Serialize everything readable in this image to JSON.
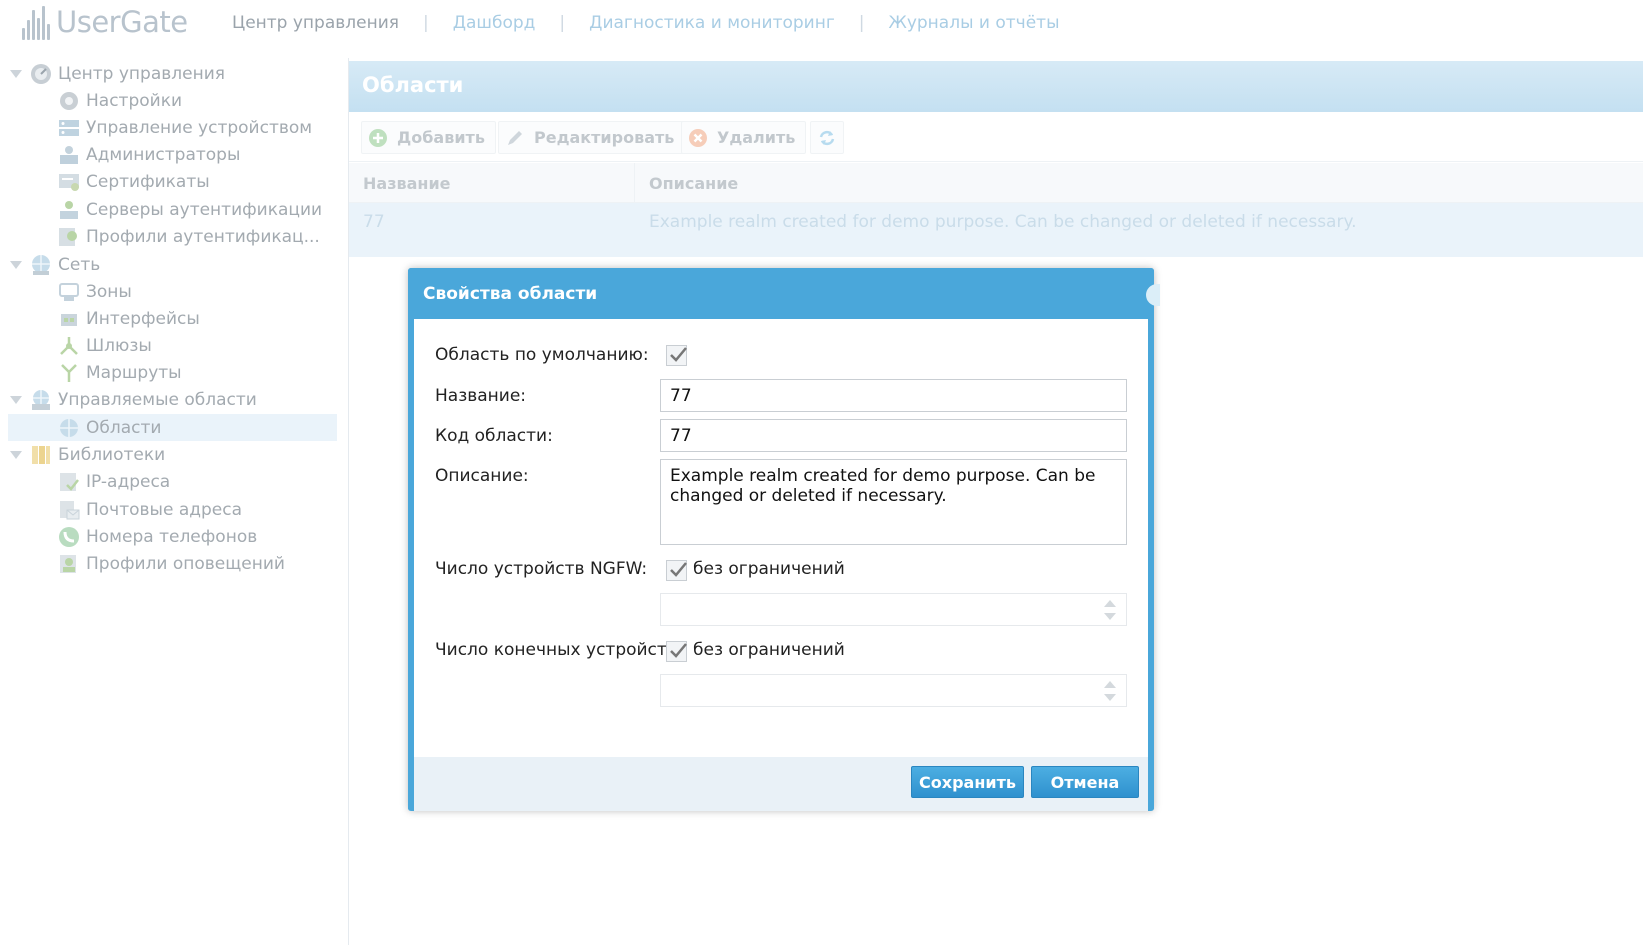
{
  "app": {
    "logo_text": "UserGate"
  },
  "topnav": {
    "items": [
      {
        "label": "Центр управления"
      },
      {
        "label": "Дашборд"
      },
      {
        "label": "Диагностика и мониторинг"
      },
      {
        "label": "Журналы и отчёты"
      }
    ],
    "separator": "|"
  },
  "sidebar": {
    "items": [
      {
        "label": "Центр управления",
        "icon": "dashboard-icon"
      },
      {
        "label": "Настройки",
        "icon": "gear-icon"
      },
      {
        "label": "Управление устройством",
        "icon": "server-icon"
      },
      {
        "label": "Администраторы",
        "icon": "admin-icon"
      },
      {
        "label": "Сертификаты",
        "icon": "certificate-icon"
      },
      {
        "label": "Серверы аутентификации",
        "icon": "auth-server-icon"
      },
      {
        "label": "Профили аутентификац...",
        "icon": "auth-profile-icon"
      },
      {
        "label": "Сеть",
        "icon": "network-globe-icon"
      },
      {
        "label": "Зоны",
        "icon": "zones-icon"
      },
      {
        "label": "Интерфейсы",
        "icon": "interfaces-icon"
      },
      {
        "label": "Шлюзы",
        "icon": "gateway-icon"
      },
      {
        "label": "Маршруты",
        "icon": "routes-icon"
      },
      {
        "label": "Управляемые области",
        "icon": "managed-realms-icon"
      },
      {
        "label": "Области",
        "icon": "realm-globe-icon",
        "selected": true
      },
      {
        "label": "Библиотеки",
        "icon": "library-icon"
      },
      {
        "label": "IP-адреса",
        "icon": "ip-address-icon"
      },
      {
        "label": "Почтовые адреса",
        "icon": "mail-address-icon"
      },
      {
        "label": "Номера телефонов",
        "icon": "phone-icon"
      },
      {
        "label": "Профили оповещений",
        "icon": "notification-profile-icon"
      }
    ]
  },
  "panel": {
    "title": "Области",
    "toolbar": {
      "add_label": "Добавить",
      "edit_label": "Редактировать",
      "delete_label": "Удалить"
    },
    "table": {
      "columns": [
        "Название",
        "Описание"
      ],
      "rows": [
        {
          "name": "77",
          "description": "Example realm created for demo purpose. Can be changed or deleted if necessary."
        }
      ]
    }
  },
  "modal": {
    "title": "Свойства области",
    "default_realm_label": "Область по умолчанию:",
    "default_realm_checked": true,
    "name_label": "Название:",
    "name_value": "77",
    "code_label": "Код области:",
    "code_value": "77",
    "description_label": "Описание:",
    "description_value": "Example realm created for demo purpose. Can be changed or deleted if necessary.",
    "ngfw_label": "Число устройств NGFW:",
    "ngfw_unlimited_label": "без ограничений",
    "ngfw_unlimited_checked": true,
    "endpoints_label": "Число конечных устройств:",
    "endpoints_unlimited_label": "без ограничений",
    "endpoints_unlimited_checked": true,
    "save_label": "Сохранить",
    "cancel_label": "Отмена"
  },
  "colors": {
    "accent": "#4aa7da",
    "panel_header": "#c4e0f1",
    "selected_row": "#eaf3fa"
  }
}
